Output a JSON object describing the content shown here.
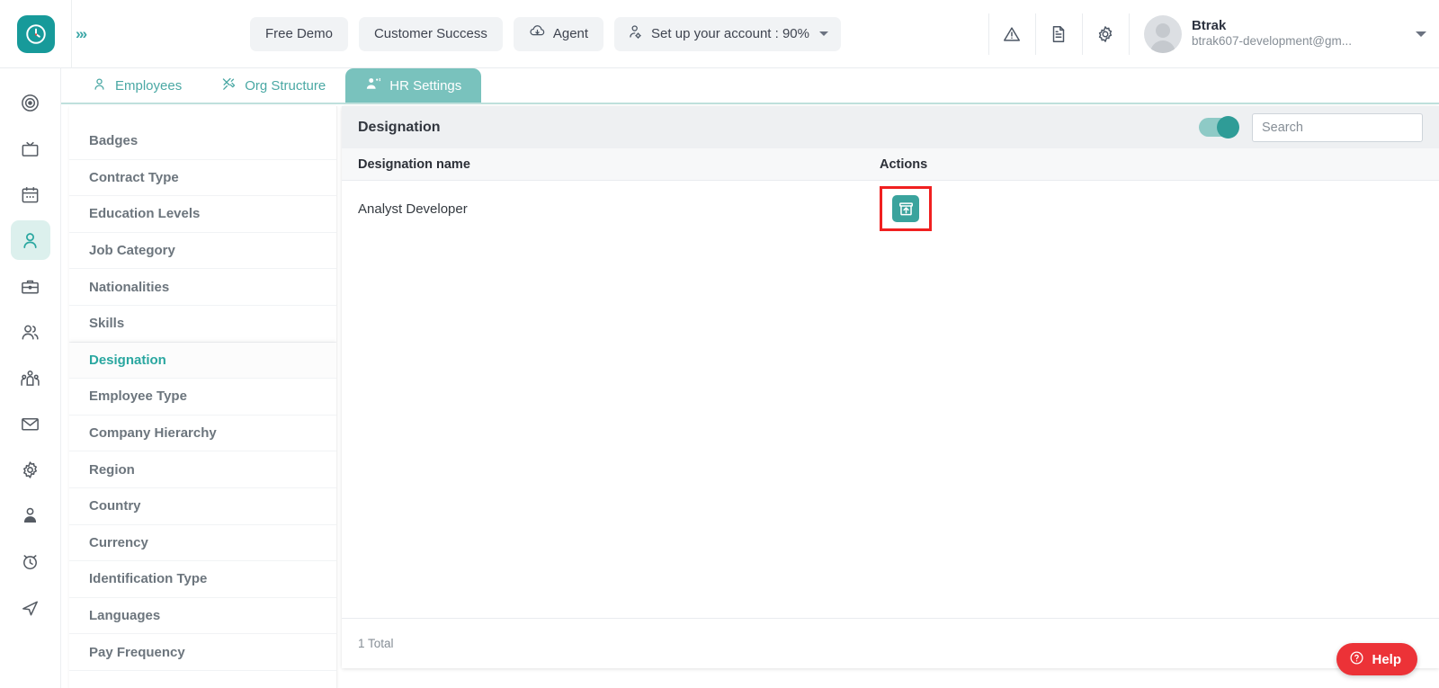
{
  "brand": {
    "logo_icon": "clock-logo-icon",
    "logo_color": "#179a9a",
    "expand_icon": "double-chevron-right-icon",
    "expand_glyph": "»›"
  },
  "topbar": {
    "buttons": [
      {
        "label": "Free Demo",
        "icon": null,
        "name": "free-demo-button"
      },
      {
        "label": "Customer Success",
        "icon": null,
        "name": "customer-success-button"
      },
      {
        "label": "Agent",
        "icon": "cloud-download-icon",
        "name": "agent-button"
      }
    ],
    "account_setup": {
      "label": "Set up your account : 90%",
      "percent": "90%",
      "icon": "user-settings-icon",
      "has_caret": true
    },
    "icons": [
      {
        "name": "alert-triangle-icon",
        "title": "Alerts"
      },
      {
        "name": "document-icon",
        "title": "Documents"
      },
      {
        "name": "gear-icon",
        "title": "Settings"
      }
    ],
    "user": {
      "name": "Btrak",
      "email": "btrak607-development@gm...",
      "avatar_icon": "avatar-placeholder-icon"
    }
  },
  "rail": {
    "items": [
      {
        "name": "sidebar-item-target",
        "icon": "target-icon",
        "active": false
      },
      {
        "name": "sidebar-item-tv",
        "icon": "tv-icon",
        "active": false
      },
      {
        "name": "sidebar-item-calendar",
        "icon": "calendar-icon",
        "active": false
      },
      {
        "name": "sidebar-item-employee",
        "icon": "user-icon",
        "active": true
      },
      {
        "name": "sidebar-item-briefcase",
        "icon": "briefcase-icon",
        "active": false
      },
      {
        "name": "sidebar-item-users",
        "icon": "users-icon",
        "active": false
      },
      {
        "name": "sidebar-item-team",
        "icon": "team-group-icon",
        "active": false
      },
      {
        "name": "sidebar-item-mail",
        "icon": "mail-icon",
        "active": false
      },
      {
        "name": "sidebar-item-settings",
        "icon": "gear-icon",
        "active": false
      },
      {
        "name": "sidebar-item-profile",
        "icon": "person-badge-icon",
        "active": false
      },
      {
        "name": "sidebar-item-timer",
        "icon": "alarm-clock-icon",
        "active": false
      },
      {
        "name": "sidebar-item-send",
        "icon": "paper-plane-icon",
        "active": false
      }
    ]
  },
  "tabs": [
    {
      "label": "Employees",
      "icon": "person-icon",
      "active": false
    },
    {
      "label": "Org Structure",
      "icon": "tools-icon",
      "active": false
    },
    {
      "label": "HR Settings",
      "icon": "people-gear-icon",
      "active": true
    }
  ],
  "settings_menu": {
    "items": [
      {
        "label": "Badges",
        "active": false
      },
      {
        "label": "Contract Type",
        "active": false
      },
      {
        "label": "Education Levels",
        "active": false
      },
      {
        "label": "Job Category",
        "active": false
      },
      {
        "label": "Nationalities",
        "active": false
      },
      {
        "label": "Skills",
        "active": false
      },
      {
        "label": "Designation",
        "active": true
      },
      {
        "label": "Employee Type",
        "active": false
      },
      {
        "label": "Company Hierarchy",
        "active": false
      },
      {
        "label": "Region",
        "active": false
      },
      {
        "label": "Country",
        "active": false
      },
      {
        "label": "Currency",
        "active": false
      },
      {
        "label": "Identification Type",
        "active": false
      },
      {
        "label": "Languages",
        "active": false
      },
      {
        "label": "Pay Frequency",
        "active": false
      }
    ]
  },
  "panel": {
    "title": "Designation",
    "toggle": {
      "name": "archived-toggle",
      "state": "on",
      "color": "#2f9c97"
    },
    "search": {
      "placeholder": "Search",
      "value": ""
    },
    "table": {
      "columns": [
        "Designation name",
        "Actions"
      ],
      "rows": [
        {
          "designation_name": "Analyst Developer",
          "action_icon": "restore-upload-icon",
          "action_highlighted": true
        }
      ]
    },
    "footer_total": "1 Total"
  },
  "help": {
    "label": "Help",
    "icon": "question-circle-icon",
    "color": "#ec3237"
  },
  "highlight_color": "#f02020",
  "accent_color": "#3aa39d"
}
